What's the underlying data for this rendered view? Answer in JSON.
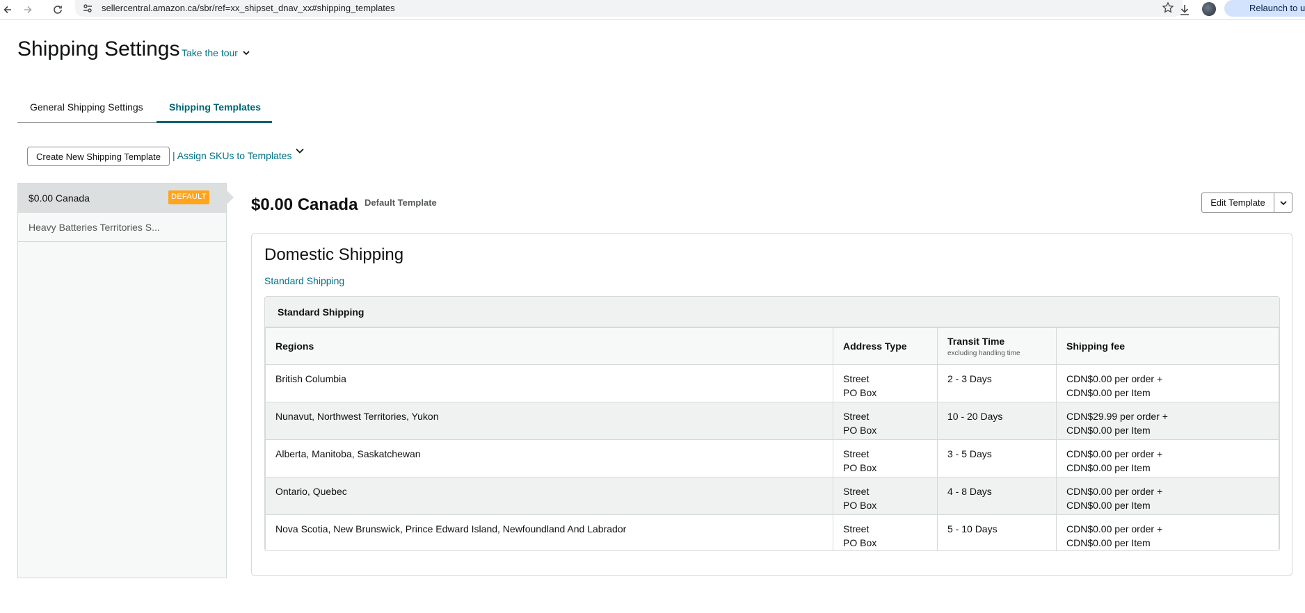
{
  "browser": {
    "url": "sellercentral.amazon.ca/sbr/ref=xx_shipset_dnav_xx#shipping_templates",
    "relaunch_label": "Relaunch to update"
  },
  "page": {
    "title": "Shipping Settings",
    "tour_label": "Take the tour"
  },
  "tabs": [
    {
      "label": "General Shipping Settings",
      "active": false
    },
    {
      "label": "Shipping Templates",
      "active": true
    }
  ],
  "actions": {
    "create_label": "Create New Shipping Template",
    "assign_label": "| Assign SKUs to Templates"
  },
  "templates": [
    {
      "name": "$0.00 Canada",
      "badge": "DEFAULT",
      "selected": true
    },
    {
      "name": "Heavy Batteries Territories S...",
      "badge": "",
      "selected": false
    }
  ],
  "template": {
    "title": "$0.00 Canada",
    "subtitle": "Default Template",
    "edit_label": "Edit Template"
  },
  "domestic": {
    "title": "Domestic Shipping",
    "link_label": "Standard Shipping",
    "box_title": "Standard Shipping",
    "headers": {
      "regions": "Regions",
      "address_type": "Address Type",
      "transit_time": "Transit Time",
      "transit_sub": "excluding handling time",
      "fee": "Shipping fee"
    },
    "rows": [
      {
        "region": "British Columbia",
        "addr1": "Street",
        "addr2": "PO Box",
        "transit": "2 - 3 Days",
        "fee1": "CDN$0.00 per order +",
        "fee2": "CDN$0.00 per Item"
      },
      {
        "region": "Nunavut, Northwest Territories, Yukon",
        "addr1": "Street",
        "addr2": "PO Box",
        "transit": "10 - 20 Days",
        "fee1": "CDN$29.99 per order +",
        "fee2": "CDN$0.00 per Item"
      },
      {
        "region": "Alberta, Manitoba, Saskatchewan",
        "addr1": "Street",
        "addr2": "PO Box",
        "transit": "3 - 5 Days",
        "fee1": "CDN$0.00 per order +",
        "fee2": "CDN$0.00 per Item"
      },
      {
        "region": "Ontario, Quebec",
        "addr1": "Street",
        "addr2": "PO Box",
        "transit": "4 - 8 Days",
        "fee1": "CDN$0.00 per order +",
        "fee2": "CDN$0.00 per Item"
      },
      {
        "region": "Nova Scotia, New Brunswick, Prince Edward Island, Newfoundland And Labrador",
        "addr1": "Street",
        "addr2": "PO Box",
        "transit": "5 - 10 Days",
        "fee1": "CDN$0.00 per order +",
        "fee2": "CDN$0.00 per Item"
      }
    ]
  },
  "colors": {
    "link": "#007185",
    "active_tab": "#006373",
    "badge": "#ffa41c",
    "row_alt": "#f0f2f2"
  },
  "icons": [
    "back-icon",
    "forward-icon",
    "reload-icon",
    "site-info-icon",
    "bookmark-star-icon",
    "download-icon",
    "profile-avatar",
    "chevron-down-icon"
  ]
}
